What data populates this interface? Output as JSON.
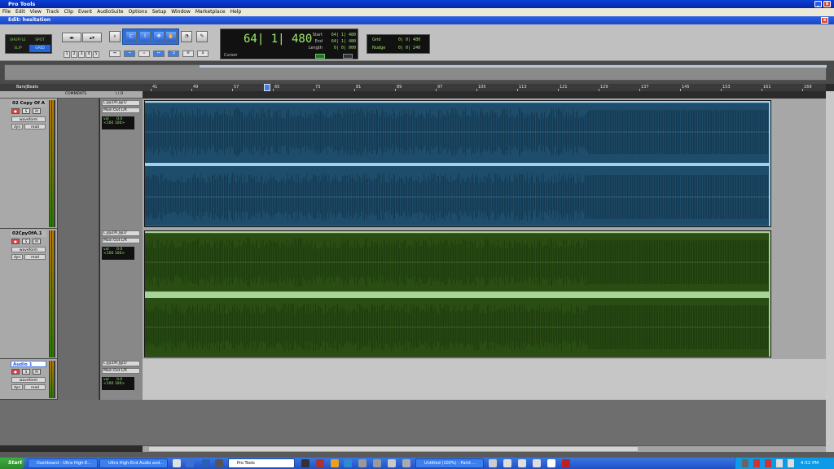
{
  "app_title": "Pro Tools",
  "menu": [
    "File",
    "Edit",
    "View",
    "Track",
    "Clip",
    "Event",
    "AudioSuite",
    "Options",
    "Setup",
    "Window",
    "Marketplace",
    "Help"
  ],
  "edit_window_title": "Edit: hesitation",
  "modes": {
    "shuffle": "SHUFFLE",
    "spot": "SPOT",
    "slip": "SLIP",
    "grid": "GRID"
  },
  "zoom_presets": [
    "1",
    "2",
    "3",
    "4",
    "5"
  ],
  "counter": {
    "main": "64| 1| 480",
    "start_label": "Start",
    "start": "64| 1| 480",
    "end_label": "End",
    "end": "64| 1| 480",
    "length_label": "Length",
    "length": "0| 0| 000",
    "cursor_label": "Cursor"
  },
  "grid": {
    "grid_label": "Grid",
    "grid_value": "0| 0| 480",
    "nudge_label": "Nudge",
    "nudge_value": "0| 0| 240"
  },
  "ruler": {
    "label": "Bars|Beats",
    "ticks": [
      "41",
      "49",
      "57",
      "65",
      "73",
      "81",
      "89",
      "97",
      "105",
      "113",
      "121",
      "129",
      "137",
      "145",
      "153",
      "161",
      "169"
    ]
  },
  "columns": {
    "comments": "COMMENTS",
    "io": "I / O"
  },
  "tracks": [
    {
      "name": "02 Copy Of A",
      "view": "waveform",
      "dyn": "dyn",
      "auto": "read",
      "input": "L.J@1/R.J@1/",
      "output": "Main Out L/R",
      "vol_label": "vol",
      "vol": "0.0",
      "pan_l": "<100",
      "pan_r": "100>",
      "color": "#2e4f6b",
      "clip_color": "#1e4d6b",
      "lane_bg": "#9fd3ec"
    },
    {
      "name": "02CpyOfA.1",
      "view": "waveform",
      "dyn": "dyn",
      "auto": "read",
      "input": "L.J@2/R.J@2/",
      "output": "Main Out L/R",
      "vol_label": "vol",
      "vol": "0.0",
      "pan_l": "<100",
      "pan_r": "100>",
      "color": "#2b5a1f",
      "clip_color": "#2a4d14",
      "lane_bg": "#a8d49a"
    },
    {
      "name": "Audio 1",
      "view": "waveform",
      "dyn": "dyn",
      "auto": "read",
      "input": "L.J@1/R.J@1/",
      "output": "Main Out L/R",
      "vol_label": "vol",
      "vol": "0.0",
      "pan_l": "<100",
      "pan_r": "100>"
    }
  ],
  "taskbar": {
    "start": "Start",
    "tasks": [
      "Dashboard - Ultra High-E...",
      "Ultra High-End Audio and...",
      "Pro Tools",
      "Untitled (100%) - Paint...."
    ],
    "clock": "4:52 PM"
  }
}
